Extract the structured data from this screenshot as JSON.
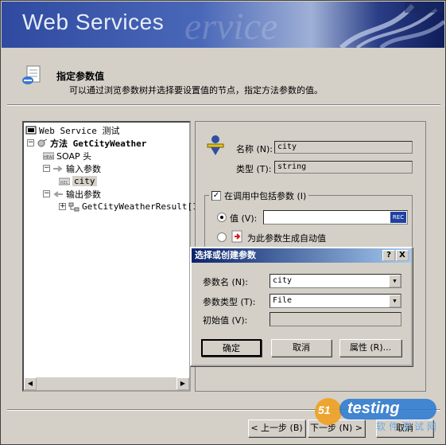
{
  "banner": {
    "title": "Web Services",
    "ghost_text": "ervice"
  },
  "header": {
    "title": "指定参数值",
    "description": "可以通过浏览参数树并选择要设置值的节点，指定方法参数的值。"
  },
  "tree": {
    "root": "Web Service 测试",
    "method": "方法 GetCityWeather",
    "soap_header": "SOAP 头",
    "input_params": "输入参数",
    "city": "city",
    "output_params": "输出参数",
    "result": "GetCityWeatherResult[1"
  },
  "details": {
    "name_label": "名称 (N):",
    "name_value": "city",
    "type_label": "类型 (T):",
    "type_value": "string",
    "include_label": "在调用中包括参数 (I)",
    "value_label": "值 (V):",
    "auto_label": "为此参数生成自动值",
    "rec_label": "REC"
  },
  "dialog": {
    "title": "选择或创建参数",
    "param_name_label": "参数名 (N):",
    "param_name_value": "city",
    "param_type_label": "参数类型 (T):",
    "param_type_value": "File",
    "initial_label": "初始值 (V):",
    "ok": "确定",
    "cancel": "取消",
    "properties": "属性 (R)...",
    "help_btn": "?",
    "close_btn": "X"
  },
  "footer": {
    "back": "< 上一步 (B)",
    "next": "下一步 (N) >",
    "cancel": "取消"
  },
  "watermark": {
    "num": "51",
    "text": "testing",
    "cn": "软件测试网"
  }
}
